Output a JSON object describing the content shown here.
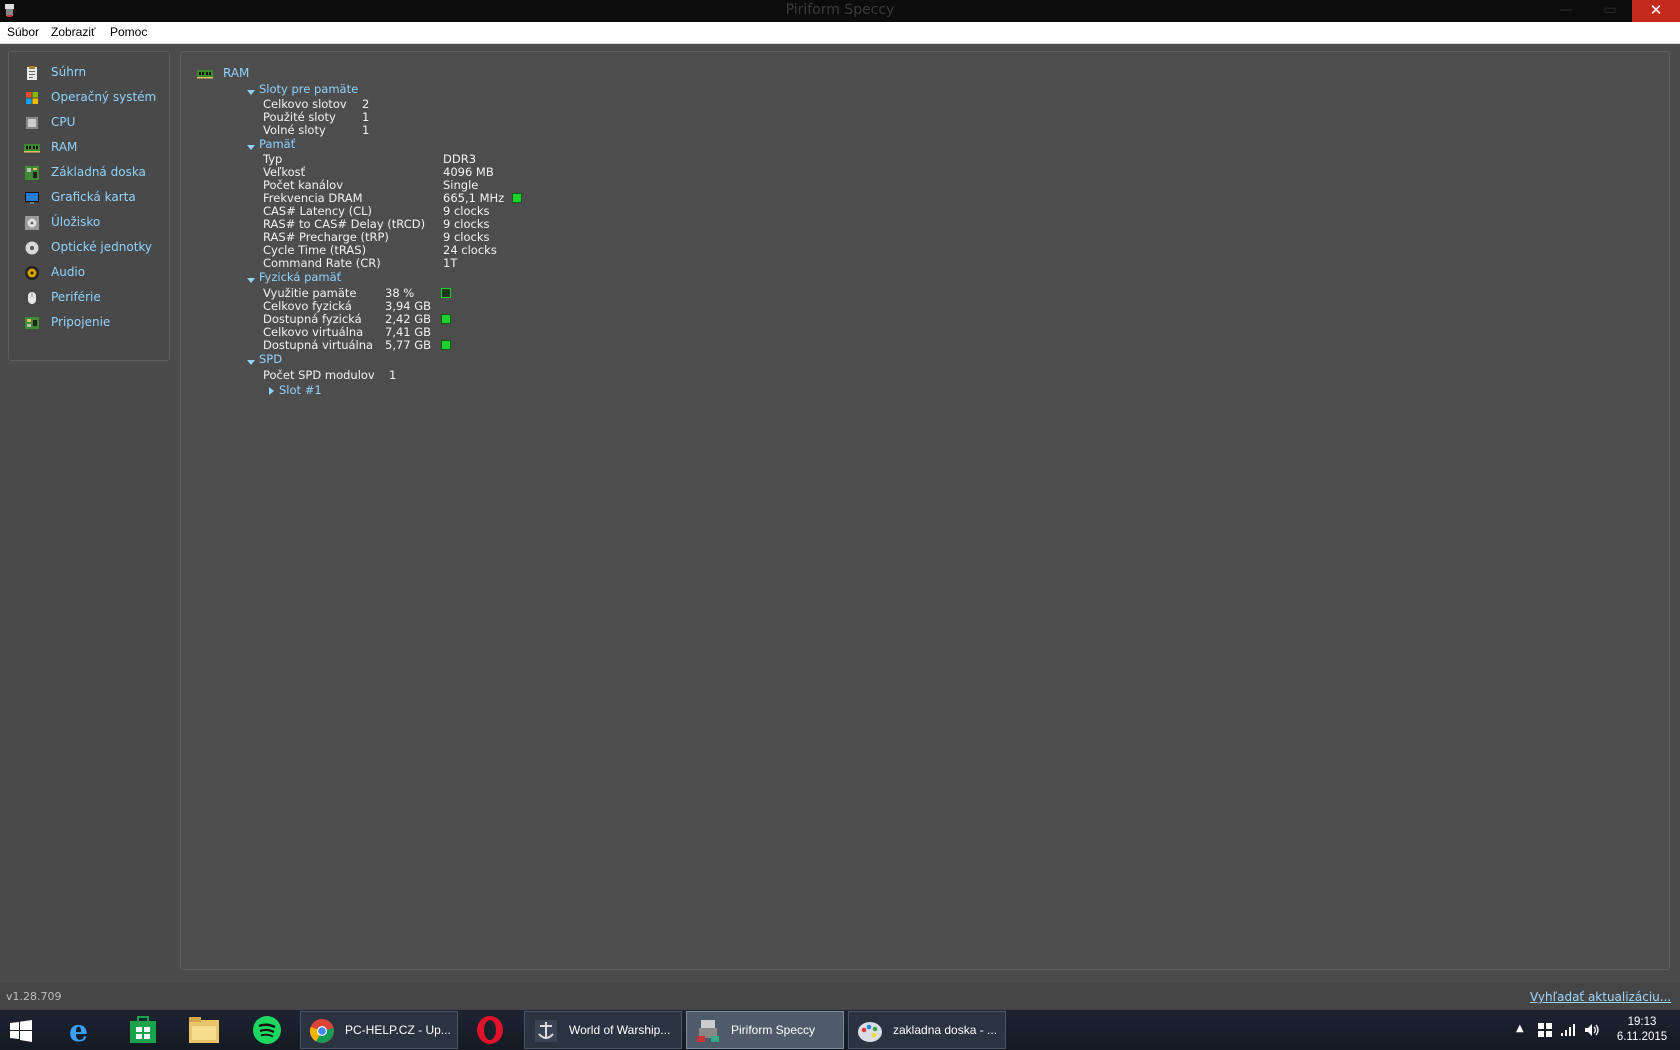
{
  "window": {
    "title": "Piriform Speccy",
    "minimize": "—",
    "maximize": "▭",
    "close": "✕"
  },
  "menu": [
    "Súbor",
    "Zobraziť",
    "Pomoc"
  ],
  "sidebar": {
    "items": [
      {
        "label": "Súhrn",
        "icon": "summary-icon"
      },
      {
        "label": "Operačný systém",
        "icon": "windows-icon"
      },
      {
        "label": "CPU",
        "icon": "cpu-icon"
      },
      {
        "label": "RAM",
        "icon": "ram-icon"
      },
      {
        "label": "Základná doska",
        "icon": "motherboard-icon"
      },
      {
        "label": "Grafická karta",
        "icon": "monitor-icon"
      },
      {
        "label": "Úložisko",
        "icon": "disk-icon"
      },
      {
        "label": "Optické jednotky",
        "icon": "optical-icon"
      },
      {
        "label": "Audio",
        "icon": "speaker-icon"
      },
      {
        "label": "Periférie",
        "icon": "mouse-icon"
      },
      {
        "label": "Pripojenie",
        "icon": "network-icon"
      }
    ]
  },
  "ram": {
    "title": "RAM",
    "slots": {
      "header": "Sloty pre pamäte",
      "rows": [
        {
          "label": "Celkovo slotov",
          "value": "2"
        },
        {
          "label": "Použité sloty",
          "value": "1"
        },
        {
          "label": "Volné sloty",
          "value": "1"
        }
      ]
    },
    "memory": {
      "header": "Pamäť",
      "rows": [
        {
          "label": "Typ",
          "value": "DDR3"
        },
        {
          "label": "Veľkosť",
          "value": "4096 MB"
        },
        {
          "label": "Počet kanálov",
          "value": "Single"
        },
        {
          "label": "Frekvencia DRAM",
          "value": "665,1 MHz"
        },
        {
          "label": "CAS# Latency (CL)",
          "value": "9 clocks"
        },
        {
          "label": "RAS# to CAS# Delay (tRCD)",
          "value": "9 clocks"
        },
        {
          "label": "RAS# Precharge (tRP)",
          "value": "9 clocks"
        },
        {
          "label": "Cycle Time (tRAS)",
          "value": "24 clocks"
        },
        {
          "label": "Command Rate (CR)",
          "value": "1T"
        }
      ]
    },
    "physical": {
      "header": "Fyzická pamäť",
      "rows": [
        {
          "label": "Využitie pamäte",
          "value": "38 %"
        },
        {
          "label": "Celkovo fyzická",
          "value": "3,94 GB"
        },
        {
          "label": "Dostupná fyzická",
          "value": "2,42 GB"
        },
        {
          "label": "Celkovo virtuálna",
          "value": "7,41 GB"
        },
        {
          "label": "Dostupná virtuálna",
          "value": "5,77 GB"
        }
      ]
    },
    "spd": {
      "header": "SPD",
      "modules_label": "Počet SPD modulov",
      "modules_value": "1",
      "slot": "Slot #1"
    }
  },
  "status": {
    "version": "v1.28.709",
    "update_link": "Vyhľadať aktualizáciu..."
  },
  "taskbar": {
    "tasks": [
      {
        "label": "PC-HELP.CZ - Up...",
        "icon": "chrome-icon"
      },
      {
        "label": "World of Warship...",
        "icon": "warships-icon"
      },
      {
        "label": "Piriform Speccy",
        "icon": "speccy-icon"
      },
      {
        "label": "zakladna doska - ...",
        "icon": "paint-icon"
      }
    ],
    "time": "19:13",
    "date": "6.11.2015"
  },
  "colors": {
    "accent_text": "#8fd3ff",
    "status_green": "#1fd12c",
    "panel_bg": "#4d4d4d"
  }
}
